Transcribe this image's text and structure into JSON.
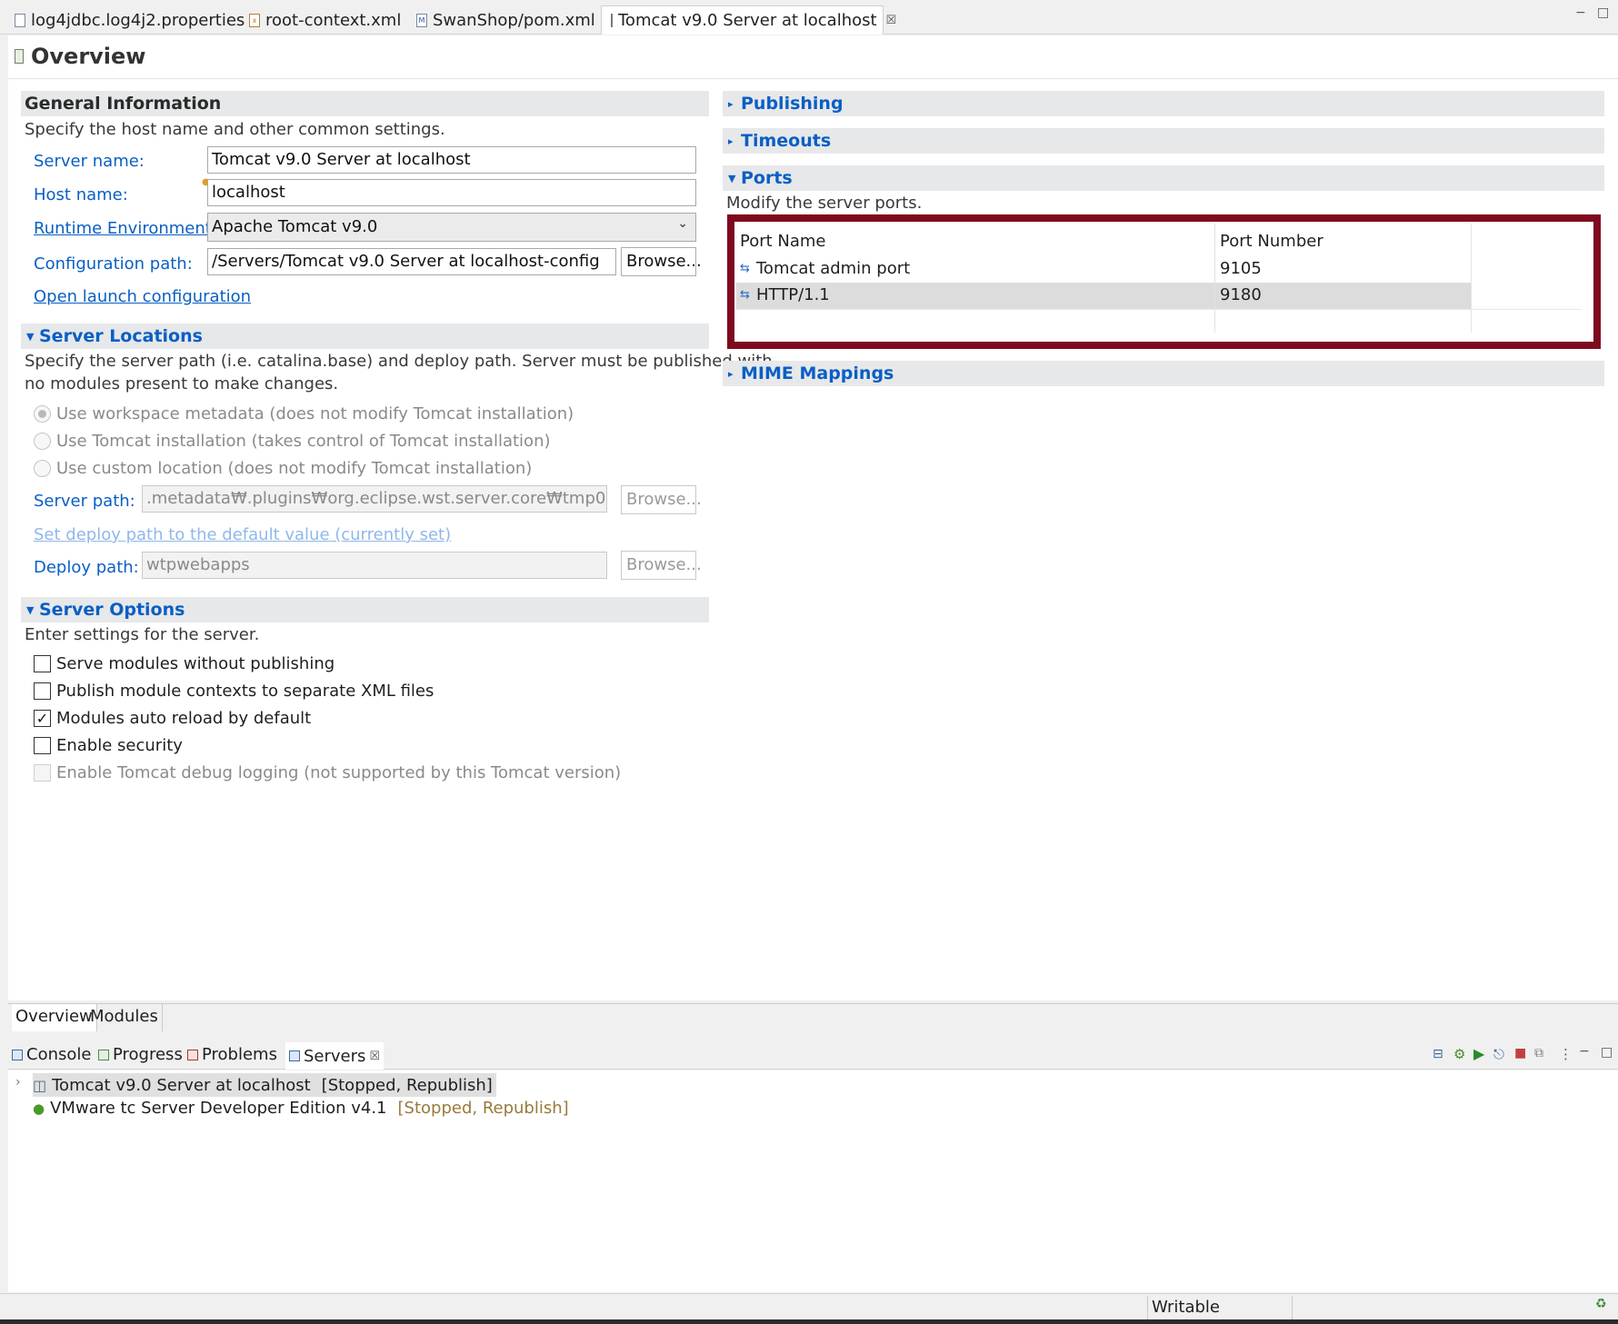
{
  "editor_tabs": [
    {
      "label": "log4jdbc.log4j2.properties",
      "icon": "properties-file-icon"
    },
    {
      "label": "root-context.xml",
      "icon": "xml-file-icon"
    },
    {
      "label": "SwanShop/pom.xml",
      "icon": "maven-pom-icon"
    },
    {
      "label": "Tomcat v9.0 Server at localhost",
      "icon": "server-icon",
      "active": true,
      "close": "☒"
    }
  ],
  "window_controls": {
    "minimize": "−",
    "maximize": "□"
  },
  "overview": {
    "title": "Overview",
    "general": {
      "header": "General Information",
      "description": "Specify the host name and other common settings.",
      "server_name_label": "Server name:",
      "server_name_value": "Tomcat v9.0 Server at localhost",
      "host_name_label": "Host name:",
      "host_name_value": "localhost",
      "runtime_label": "Runtime Environment:",
      "runtime_value": "Apache Tomcat v9.0",
      "config_label": "Configuration path:",
      "config_value": "/Servers/Tomcat v9.0 Server at localhost-config",
      "browse_label": "Browse...",
      "open_launch_label": "Open launch configuration"
    },
    "locations": {
      "header": "Server Locations",
      "description_1": "Specify the server path (i.e. catalina.base) and deploy path. Server must be published with",
      "description_2": "no modules present to make changes.",
      "radio_workspace": "Use workspace metadata (does not modify Tomcat installation)",
      "radio_tomcat": "Use Tomcat installation (takes control of Tomcat installation)",
      "radio_custom": "Use custom location (does not modify Tomcat installation)",
      "selected_radio": "workspace",
      "server_path_label": "Server path:",
      "server_path_value": ".metadata₩.plugins₩org.eclipse.wst.server.core₩tmp0",
      "browse_label": "Browse...",
      "set_deploy_label": "Set deploy path to the default value (currently set)",
      "deploy_path_label": "Deploy path:",
      "deploy_path_value": "wtpwebapps"
    },
    "options": {
      "header": "Server Options",
      "description": "Enter settings for the server.",
      "items": [
        {
          "label": "Serve modules without publishing",
          "checked": false,
          "enabled": true
        },
        {
          "label": "Publish module contexts to separate XML files",
          "checked": false,
          "enabled": true
        },
        {
          "label": "Modules auto reload by default",
          "checked": true,
          "enabled": true
        },
        {
          "label": "Enable security",
          "checked": false,
          "enabled": true
        },
        {
          "label": "Enable Tomcat debug logging (not supported by this Tomcat version)",
          "checked": false,
          "enabled": false
        }
      ]
    }
  },
  "right_sections": {
    "publishing": "Publishing",
    "timeouts": "Timeouts",
    "ports": {
      "header": "Ports",
      "description": "Modify the server ports.",
      "columns": [
        "Port Name",
        "Port Number"
      ],
      "rows": [
        {
          "name": "Tomcat admin port",
          "number": "9105"
        },
        {
          "name": "HTTP/1.1",
          "number": "9180"
        }
      ]
    },
    "mime": "MIME Mappings"
  },
  "bottom_editor_tabs": [
    "Overview",
    "Modules"
  ],
  "views": {
    "tabs": [
      "Console",
      "Progress",
      "Problems",
      "Servers"
    ],
    "active": "Servers",
    "close": "☒",
    "servers": [
      {
        "name": "Tomcat v9.0 Server at localhost",
        "status": "[Stopped, Republish]",
        "selected": true
      },
      {
        "name": "VMware tc Server Developer Edition v4.1",
        "status": "[Stopped, Republish]",
        "selected": false
      }
    ]
  },
  "statusbar": {
    "writable": "Writable"
  },
  "colors": {
    "link": "#0a5fc4",
    "highlight_frame": "#7d0a1e",
    "status_olive": "#9a7a3a"
  }
}
